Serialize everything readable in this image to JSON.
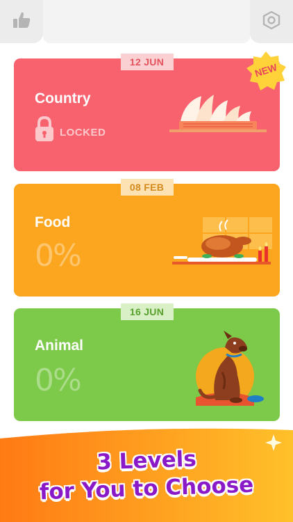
{
  "topbar": {
    "like_icon": "thumbs-up-icon",
    "settings_icon": "hexagon-settings-icon"
  },
  "cards": [
    {
      "date": "12 JUN",
      "title": "Country",
      "status": "LOCKED",
      "badge": "NEW",
      "color": "#f7626e",
      "icon": "sydney-opera-house-illustration"
    },
    {
      "date": "08 FEB",
      "title": "Food",
      "progress": "0%",
      "color": "#fca61f",
      "icon": "roast-turkey-dinner-illustration"
    },
    {
      "date": "16 JUN",
      "title": "Animal",
      "progress": "0%",
      "color": "#7dc94a",
      "icon": "sitting-dog-illustration"
    }
  ],
  "promo": {
    "line1": "3 Levels",
    "line2": "for You to Choose",
    "text_color": "#8a19c8"
  }
}
